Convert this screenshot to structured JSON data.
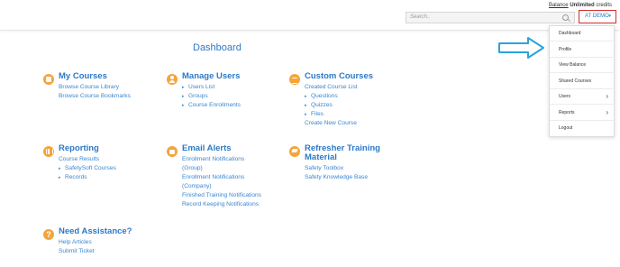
{
  "header": {
    "balance_link": "Balance",
    "credits_value": "Unlimited",
    "credits_suffix": "credits",
    "search_placeholder": "Search..",
    "user_button": "AT DEMO",
    "user_caret": "▾"
  },
  "page_title": "Dashboard",
  "user_menu": {
    "items": [
      {
        "label": "Dashboard",
        "chevron": ""
      },
      {
        "label": "Profile",
        "chevron": ""
      },
      {
        "label": "View Balance",
        "chevron": ""
      },
      {
        "label": "Shared Courses",
        "chevron": ""
      },
      {
        "label": "Users",
        "chevron": "›"
      },
      {
        "label": "Reports",
        "chevron": "›"
      },
      {
        "label": "Logout",
        "chevron": ""
      }
    ]
  },
  "sections": {
    "my_courses": {
      "title": "My Courses",
      "items": [
        "Browse Course Library",
        "Browse Course Bookmarks"
      ]
    },
    "manage_users": {
      "title": "Manage Users",
      "items": [
        "Users List",
        "Groups",
        "Course Enrollments"
      ]
    },
    "custom_courses": {
      "title": "Custom Courses",
      "items": [
        "Created Course List",
        "Questions",
        "Quizzes",
        "Files",
        "Create New Course"
      ]
    },
    "reporting": {
      "title": "Reporting",
      "items": [
        "Course Results",
        "SafetySoft Courses",
        "Records"
      ]
    },
    "email_alerts": {
      "title": "Email Alerts",
      "items": [
        "Enrollment Notifications",
        "(Group)",
        "Enrollment Notifications",
        "(Company)",
        "Finished Training Notifications",
        "Record Keeping Notifications"
      ]
    },
    "refresher": {
      "title_line1": "Refresher Training",
      "title_line2": "Material",
      "items": [
        "Safety Toolbox",
        "Safety Knowledge Base"
      ]
    },
    "assistance": {
      "title": "Need Assistance?",
      "items": [
        "Help Articles",
        "Submit Ticket"
      ]
    }
  },
  "colors": {
    "accent": "#2d79c7",
    "icon_orange": "#f5a43b",
    "highlight_red": "#d42d2d"
  }
}
